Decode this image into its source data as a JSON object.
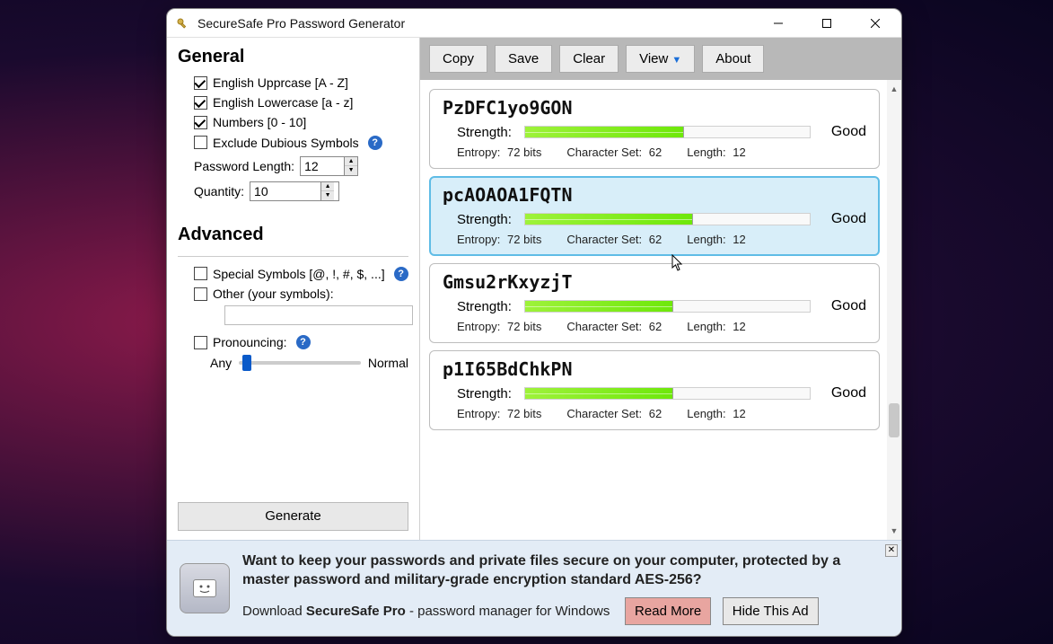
{
  "title": "SecureSafe Pro Password Generator",
  "sections": {
    "general": "General",
    "advanced": "Advanced"
  },
  "checks": {
    "upper": {
      "label": "English Upprcase [A - Z]",
      "checked": true
    },
    "lower": {
      "label": "English Lowercase [a - z]",
      "checked": true
    },
    "numbers": {
      "label": "Numbers [0 - 10]",
      "checked": true
    },
    "dubious": {
      "label": "Exclude Dubious Symbols",
      "checked": false
    },
    "special": {
      "label": "Special Symbols [@, !, #, $, ...]",
      "checked": false
    },
    "other": {
      "label": "Other (your symbols):",
      "checked": false
    },
    "pronoun": {
      "label": "Pronouncing:",
      "checked": false
    }
  },
  "pwdlen": {
    "label": "Password Length:",
    "value": "12"
  },
  "qty": {
    "label": "Quantity:",
    "value": "10"
  },
  "slider": {
    "left": "Any",
    "right": "Normal"
  },
  "generate": "Generate",
  "toolbar": {
    "copy": "Copy",
    "save": "Save",
    "clear": "Clear",
    "view": "View",
    "about": "About"
  },
  "strength_label": "Strength:",
  "meta_labels": {
    "entropy": "Entropy:",
    "charset": "Character Set:",
    "length": "Length:"
  },
  "passwords": [
    {
      "pwd": "PzDFC1yo9GON",
      "strength": "Good",
      "entropy": "72  bits",
      "charset": "62",
      "length": "12",
      "fill": 56,
      "selected": false
    },
    {
      "pwd": "pcAOAOA1FQTN",
      "strength": "Good",
      "entropy": "72  bits",
      "charset": "62",
      "length": "12",
      "fill": 59,
      "selected": true
    },
    {
      "pwd": "Gmsu2rKxyzjT",
      "strength": "Good",
      "entropy": "72  bits",
      "charset": "62",
      "length": "12",
      "fill": 52,
      "selected": false
    },
    {
      "pwd": "p1I65BdChkPN",
      "strength": "Good",
      "entropy": "72  bits",
      "charset": "62",
      "length": "12",
      "fill": 52,
      "selected": false
    }
  ],
  "ad": {
    "headline": "Want to keep your passwords and private files secure on your computer, protected by a master password and military-grade encryption standard AES-256?",
    "sub_pre": "Download ",
    "sub_bold": "SecureSafe Pro",
    "sub_post": " - password manager for Windows",
    "read": "Read More",
    "hide": "Hide This Ad"
  }
}
